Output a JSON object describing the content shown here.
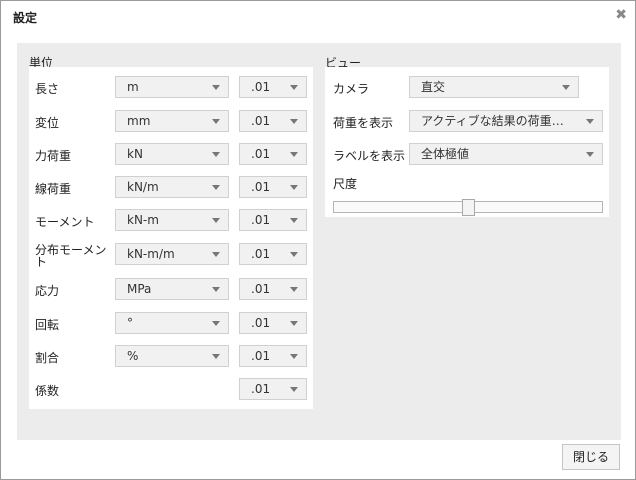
{
  "dialog": {
    "title": "設定",
    "close_icon": "close-icon",
    "close_glyph": "✖",
    "close_button_label": "閉じる"
  },
  "units": {
    "heading": "単位",
    "rows": [
      {
        "label": "長さ",
        "unit": "m",
        "precision": ".01"
      },
      {
        "label": "変位",
        "unit": "mm",
        "precision": ".01"
      },
      {
        "label": "力荷重",
        "unit": "kN",
        "precision": ".01"
      },
      {
        "label": "線荷重",
        "unit": "kN/m",
        "precision": ".01"
      },
      {
        "label": "モーメント",
        "unit": "kN-m",
        "precision": ".01"
      },
      {
        "label": "分布モーメント",
        "unit": "kN-m/m",
        "precision": ".01"
      },
      {
        "label": "応力",
        "unit": "MPa",
        "precision": ".01"
      },
      {
        "label": "回転",
        "unit": "°",
        "precision": ".01"
      },
      {
        "label": "割合",
        "unit": "%",
        "precision": ".01"
      },
      {
        "label": "係数",
        "unit": null,
        "precision": ".01"
      }
    ]
  },
  "view": {
    "heading": "ビュー",
    "camera": {
      "label": "カメラ",
      "value": "直交"
    },
    "show_load": {
      "label": "荷重を表示",
      "value": "アクティブな結果の荷重ケース"
    },
    "show_label": {
      "label": "ラベルを表示",
      "value": "全体極値"
    },
    "scale": {
      "label": "尺度",
      "value": 0.5
    }
  },
  "colors": {
    "background": "#ececec",
    "panel": "#ffffff",
    "select_bg": "#f1f1f1",
    "border": "#d0d0d0"
  }
}
